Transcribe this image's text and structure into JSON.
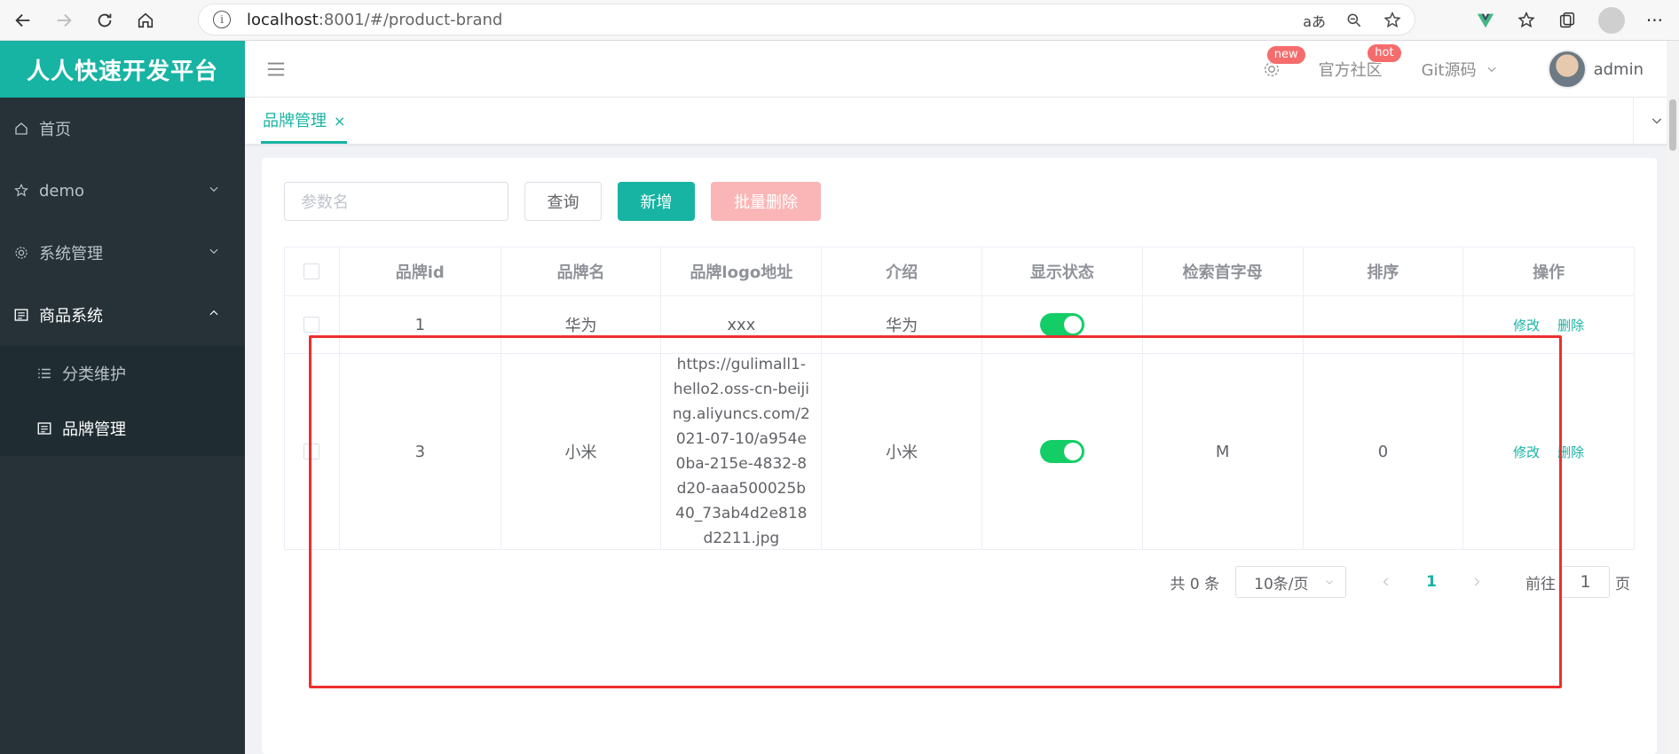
{
  "browser": {
    "url_host": "localhost",
    "url_rest": ":8001/#/product-brand",
    "translate_label": "aあ",
    "more_label": "···"
  },
  "sidebar": {
    "brand": "人人快速开发平台",
    "items": [
      {
        "label": "首页",
        "icon": "home-icon"
      },
      {
        "label": "demo",
        "icon": "star-icon"
      },
      {
        "label": "系统管理",
        "icon": "gear-icon"
      },
      {
        "label": "商品系统",
        "icon": "board-icon"
      }
    ],
    "submenu": [
      {
        "label": "分类维护",
        "icon": "list-icon"
      },
      {
        "label": "品牌管理",
        "icon": "board-icon"
      }
    ]
  },
  "header": {
    "gear_badge": "new",
    "community": "官方社区",
    "community_badge": "hot",
    "git": "Git源码",
    "user": "admin"
  },
  "tabs": {
    "active": "品牌管理",
    "close": "×"
  },
  "toolbar": {
    "search_placeholder": "参数名",
    "query": "查询",
    "add": "新增",
    "batch_delete": "批量删除"
  },
  "table": {
    "headers": [
      "品牌id",
      "品牌名",
      "品牌logo地址",
      "介绍",
      "显示状态",
      "检索首字母",
      "排序",
      "操作"
    ],
    "rows": [
      {
        "id": "1",
        "name": "华为",
        "logo": "xxx",
        "desc": "华为",
        "status": true,
        "letter": "",
        "sort": "",
        "edit": "修改",
        "delete": "删除"
      },
      {
        "id": "3",
        "name": "小米",
        "logo": "https://gulimall1-hello2.oss-cn-beijing.aliyuncs.com/2021-07-10/a954e0ba-215e-4832-8d20-aaa500025b40_73ab4d2e818d2211.jpg",
        "desc": "小米",
        "status": true,
        "letter": "M",
        "sort": "0",
        "edit": "修改",
        "delete": "删除"
      }
    ]
  },
  "pagination": {
    "total": "共 0 条",
    "page_size": "10条/页",
    "current": "1",
    "goto": "前往",
    "goto_value": "1",
    "page_suffix": "页"
  },
  "colors": {
    "accent": "#17b3a3",
    "sidebar_bg": "#263238",
    "switch_on": "#13ce66",
    "danger_disabled": "#fab6b6",
    "annotation": "#ee2e2e"
  }
}
